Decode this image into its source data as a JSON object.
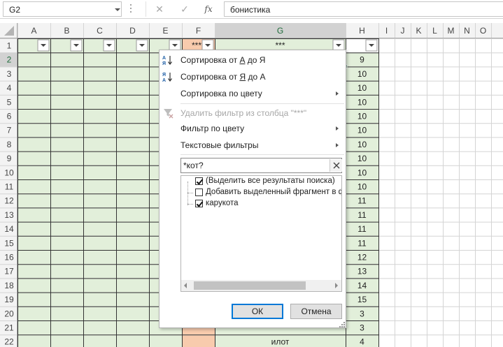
{
  "formula_bar": {
    "name_box": "G2",
    "cancel_glyph": "✕",
    "enter_glyph": "✓",
    "fx_label": "fx",
    "formula_value": "бонистика"
  },
  "sheet": {
    "columns": [
      "A",
      "B",
      "C",
      "D",
      "E",
      "F",
      "G",
      "H",
      "I",
      "J",
      "K",
      "L",
      "M",
      "N",
      "O"
    ],
    "rows": [
      "1",
      "2",
      "3",
      "4",
      "5",
      "6",
      "7",
      "8",
      "9",
      "10",
      "11",
      "12",
      "13",
      "14",
      "15",
      "16",
      "17",
      "18",
      "19",
      "20",
      "21",
      "22"
    ],
    "header_row": {
      "F": "***",
      "G": "***"
    },
    "h_values": [
      "9",
      "10",
      "10",
      "10",
      "10",
      "10",
      "10",
      "10",
      "10",
      "10",
      "11",
      "11",
      "11",
      "11",
      "12",
      "13",
      "14",
      "15",
      "3",
      "3",
      "4"
    ],
    "g22_value": "илот",
    "colors": {
      "green_fill": "#e2efda",
      "orange_fill": "#f8cbad",
      "selected_header": "#d2d2d2",
      "accent": "#217346"
    }
  },
  "filter_menu": {
    "sort_asc": {
      "pre": "Сортировка от ",
      "ul": "А",
      "post": " до Я"
    },
    "sort_desc": {
      "pre": "Сортировка от ",
      "ul": "Я",
      "post": " до А"
    },
    "sort_by_color": "Сортировка по цвету",
    "clear_filter": "Удалить фильтр из столбца \"***\"",
    "filter_by_color": "Фильтр по цвету",
    "text_filters": "Текстовые фильтры",
    "search_value": "*кот?",
    "list_items": [
      {
        "label": "(Выделить все результаты поиска)",
        "checked": true
      },
      {
        "label": "Добавить выделенный фрагмент в фильтр",
        "checked": false
      },
      {
        "label": "карукота",
        "checked": true
      }
    ],
    "ok_label": "ОК",
    "cancel_label": "Отмена"
  }
}
